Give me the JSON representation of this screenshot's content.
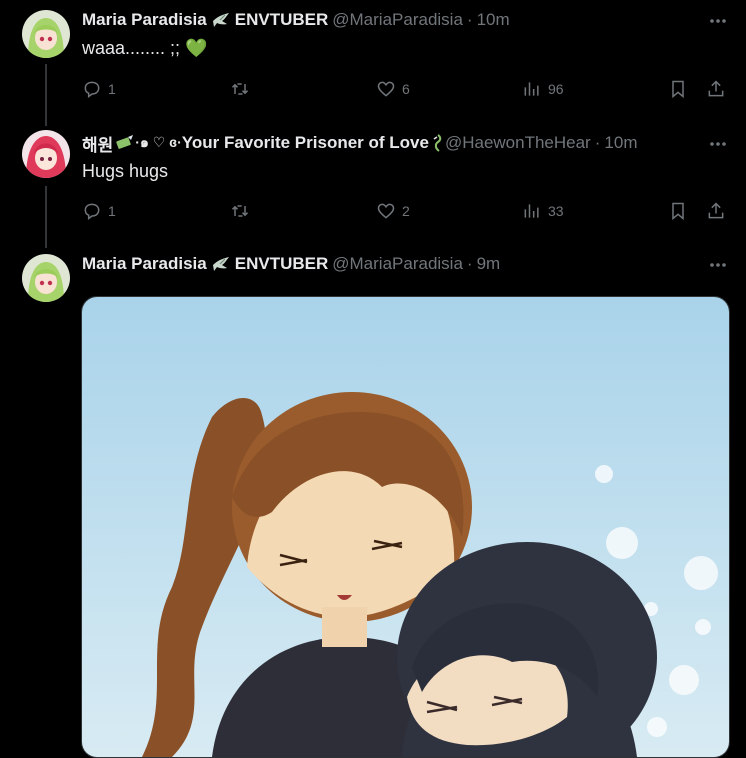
{
  "tweets": [
    {
      "name": "Maria Paradisia",
      "badge": "ENVTUBER",
      "handle": "@MariaParadisia",
      "time": "10m",
      "text": "waaa........ ;; ",
      "heart_emoji": "💚",
      "reply_count": "1",
      "retweet_count": "",
      "like_count": "6",
      "view_count": "96"
    },
    {
      "name_prefix": "해원",
      "name_deco": "·๑ ♡ ɞ·",
      "name": "Your Favorite Prisoner of Love",
      "handle": "@HaewonTheHear",
      "time": "10m",
      "text": "Hugs hugs",
      "reply_count": "1",
      "retweet_count": "",
      "like_count": "2",
      "view_count": "33"
    },
    {
      "name": "Maria Paradisia",
      "badge": "ENVTUBER",
      "handle": "@MariaParadisia",
      "time": "9m"
    }
  ],
  "dot": "·",
  "colors": {
    "background": "#000000",
    "text": "#e7e9ea",
    "muted": "#71767b",
    "heart": "#3fa34d"
  }
}
